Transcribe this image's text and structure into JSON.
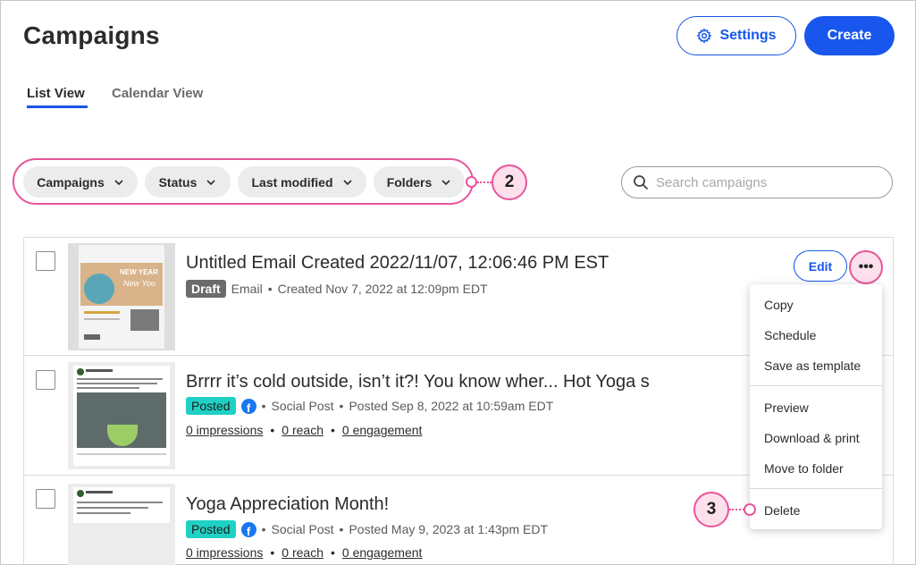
{
  "header": {
    "title": "Campaigns",
    "settings_label": "Settings",
    "create_label": "Create"
  },
  "tabs": [
    {
      "label": "List View",
      "active": true
    },
    {
      "label": "Calendar View",
      "active": false
    }
  ],
  "filters": [
    {
      "label": "Campaigns"
    },
    {
      "label": "Status"
    },
    {
      "label": "Last modified"
    },
    {
      "label": "Folders"
    }
  ],
  "search": {
    "placeholder": "Search campaigns"
  },
  "callouts": {
    "filters_num": "2",
    "delete_num": "3"
  },
  "rows": [
    {
      "title": "Untitled Email Created 2022/11/07, 12:06:46 PM EST",
      "badge": "Draft",
      "type": "Email",
      "detail": "Created Nov 7, 2022 at 12:09pm EDT",
      "thumb_text_1": "NEW YEAR",
      "thumb_text_2": "New You"
    },
    {
      "title": "Brrrr it’s cold outside, isn’t it?! You know wher...  Hot Yoga s",
      "badge": "Posted",
      "type": "Social Post",
      "detail": "Posted  Sep 8, 2022 at 10:59am EDT",
      "impressions": "0 impressions",
      "reach": "0 reach",
      "engagement": "0 engagement"
    },
    {
      "title": "Yoga Appreciation Month!",
      "badge": "Posted",
      "type": "Social Post",
      "detail": "Posted May 9, 2023 at 1:43pm EDT",
      "impressions": "0 impressions",
      "reach": "0 reach",
      "engagement": "0 engagement"
    }
  ],
  "row_actions": {
    "edit_label": "Edit",
    "more_label": "•••"
  },
  "menu": {
    "items": [
      "Copy",
      "Schedule",
      "Save as template",
      "Preview",
      "Download & print",
      "Move to folder",
      "Delete"
    ]
  },
  "colors": {
    "accent": "#1856ed",
    "callout": "#e8549a",
    "posted": "#1fd1c4",
    "draft": "#6b6b6b"
  }
}
